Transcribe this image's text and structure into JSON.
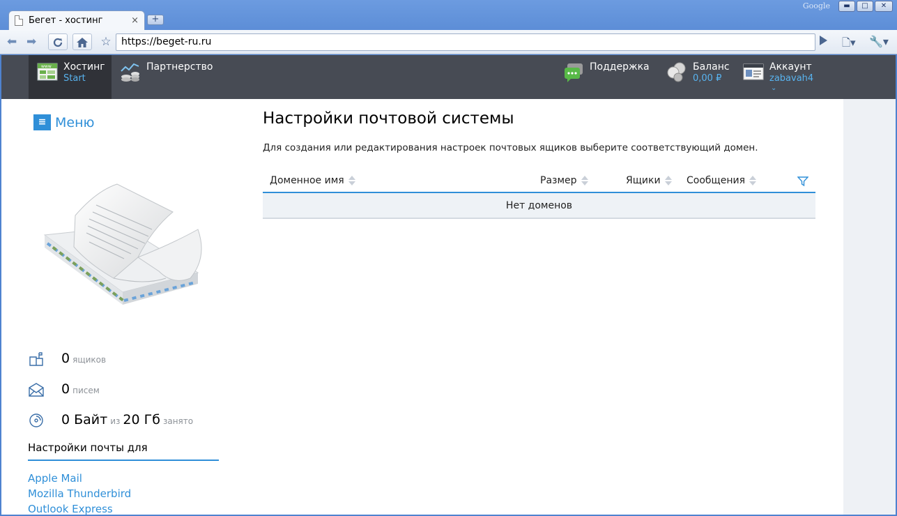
{
  "browser": {
    "brand": "Google",
    "tab_title": "Бегет - хостинг",
    "tab_close": "×",
    "new_tab": "+",
    "url": "https://beget-ru.ru",
    "window_controls": {
      "minimize": "▬",
      "maximize": "□",
      "close": "✕"
    }
  },
  "topnav": {
    "hosting": {
      "label": "Хостинг",
      "sub": "Start",
      "icon": "www-server-icon"
    },
    "partnership": {
      "label": "Партнерство",
      "icon": "chart-coins-icon"
    },
    "support": {
      "label": "Поддержка",
      "icon": "chat-bubbles-icon"
    },
    "balance": {
      "label": "Баланс",
      "sub": "0,00 ₽",
      "icon": "coins-icon"
    },
    "account": {
      "label": "Аккаунт",
      "sub": "zabavah4",
      "icon": "id-card-icon",
      "chevron": "⌄"
    }
  },
  "sidebar": {
    "menu_label": "Меню",
    "menu_glyph": "≡",
    "stats": {
      "boxes": {
        "value": "0",
        "unit": "ящиков"
      },
      "letters": {
        "value": "0",
        "unit": "писем"
      },
      "storage": {
        "used": "0 Байт",
        "of": "из",
        "total": "20 Гб",
        "suffix": "занято"
      }
    },
    "mail_settings_title": "Настройки почты для",
    "mail_clients": [
      "Apple Mail",
      "Mozilla Thunderbird",
      "Outlook Express"
    ]
  },
  "main": {
    "title": "Настройки почтовой системы",
    "description": "Для создания или редактирования настроек почтовых ящиков выберите соответствующий домен.",
    "columns": [
      "Доменное имя",
      "Размер",
      "Ящики",
      "Сообщения"
    ],
    "empty_text": "Нет доменов"
  },
  "colors": {
    "accent": "#2f8fd8",
    "nav_bg": "#474b54",
    "nav_active": "#303238",
    "link": "#58b3ef"
  }
}
